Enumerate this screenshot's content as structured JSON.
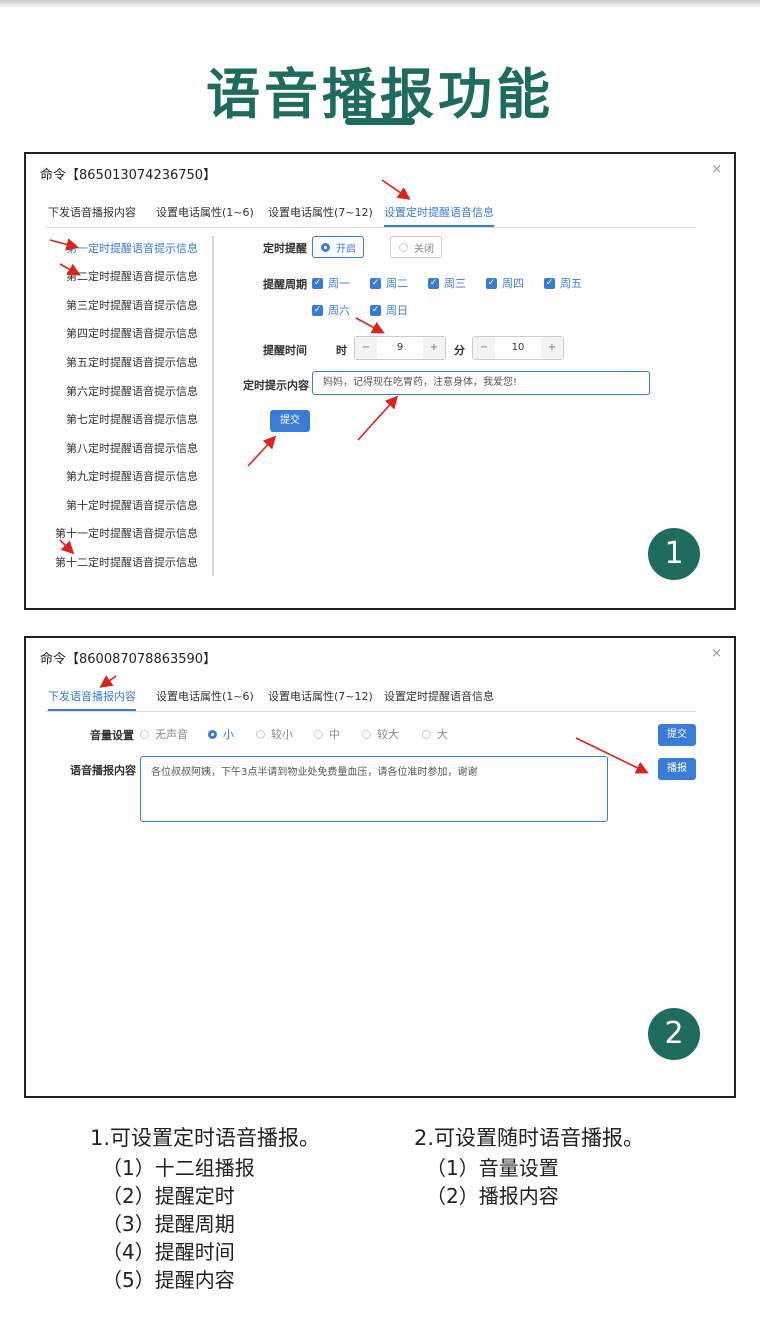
{
  "header": {
    "title": "语音播报功能"
  },
  "panel1": {
    "command": "命令【865013074236750】",
    "close": "×",
    "tabs": [
      "下发语音播报内容",
      "设置电话属性(1~6)",
      "设置电话属性(7~12)",
      "设置定时提醒语音信息"
    ],
    "active_tab": 3,
    "side_items": [
      "第一定时提醒语音提示信息",
      "第二定时提醒语音提示信息",
      "第三定时提醒语音提示信息",
      "第四定时提醒语音提示信息",
      "第五定时提醒语音提示信息",
      "第六定时提醒语音提示信息",
      "第七定时提醒语音提示信息",
      "第八定时提醒语音提示信息",
      "第九定时提醒语音提示信息",
      "第十定时提醒语音提示信息",
      "第十一定时提醒语音提示信息",
      "第十二定时提醒语音提示信息"
    ],
    "reminder_label": "定时提醒",
    "reminder_on": "开启",
    "reminder_off": "关闭",
    "period_label": "提醒周期",
    "days": [
      "周一",
      "周二",
      "周三",
      "周四",
      "周五",
      "周六",
      "周日"
    ],
    "time_label": "提醒时间",
    "hour_label": "时",
    "hour_value": "9",
    "minute_label": "分",
    "minute_value": "10",
    "minus": "−",
    "plus": "+",
    "content_label": "定时提示内容",
    "content_value": "妈妈，记得现在吃胃药，注意身体，我爱您!",
    "submit": "提交",
    "badge": "1"
  },
  "panel2": {
    "command": "命令【860087078863590】",
    "close": "×",
    "tabs": [
      "下发语音播报内容",
      "设置电话属性(1~6)",
      "设置电话属性(7~12)",
      "设置定时提醒语音信息"
    ],
    "active_tab": 0,
    "volume_label": "音量设置",
    "volume_options": [
      "无声音",
      "小",
      "较小",
      "中",
      "较大",
      "大"
    ],
    "volume_selected": 1,
    "content_label": "语音播报内容",
    "content_value": "各位叔叔阿姨，下午3点半请到物业处免费量血压，请各位准时参加，谢谢",
    "submit": "提交",
    "play": "播报",
    "badge": "2"
  },
  "notes": {
    "left_head": "1.可设置定时语音播报。",
    "left_items": [
      "（1）十二组播报",
      "（2）提醒定时",
      "（3）提醒周期",
      "（4）提醒时间",
      "（5）提醒内容"
    ],
    "right_head": "2.可设置随时语音播报。",
    "right_items": [
      "（1）音量设置",
      "（2）播报内容"
    ]
  },
  "colors": {
    "brand": "#1f6b5c",
    "accent": "#3a7bd5",
    "arrow": "#d9231d"
  }
}
